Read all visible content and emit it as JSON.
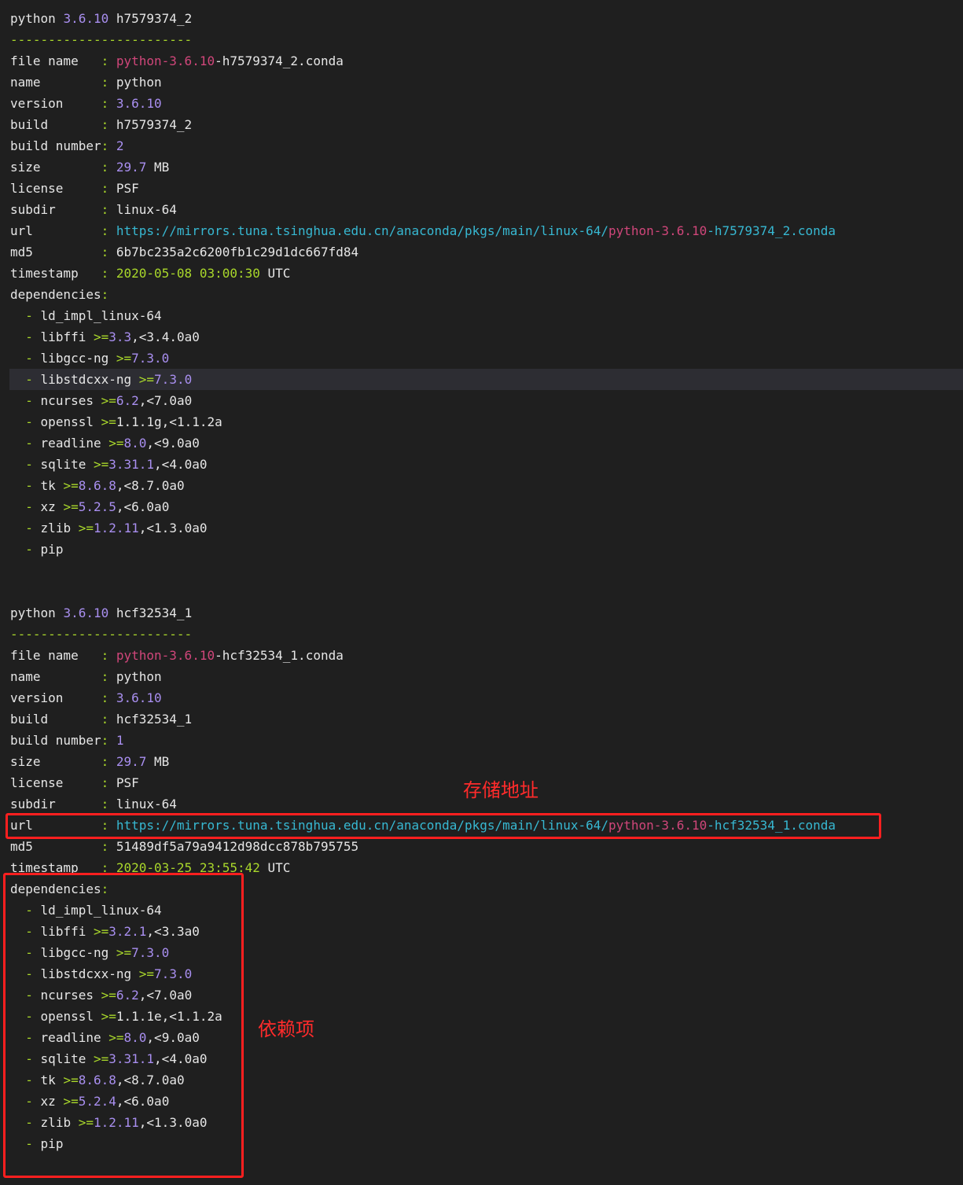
{
  "blocks": [
    {
      "title": [
        "python ",
        "3.6.10",
        " h7579374_2"
      ],
      "separator": "------------------------",
      "fields": [
        {
          "key": "file name   ",
          "value": [
            [
              "s",
              "python-3.6.10"
            ],
            [
              "w",
              "-h7579374_2.conda"
            ]
          ]
        },
        {
          "key": "name        ",
          "value": [
            [
              "w",
              "python"
            ]
          ]
        },
        {
          "key": "version     ",
          "value": [
            [
              "n",
              "3.6.10"
            ]
          ]
        },
        {
          "key": "build       ",
          "value": [
            [
              "w",
              "h7579374_2"
            ]
          ]
        },
        {
          "key": "build number",
          "value": [
            [
              "n",
              "2"
            ]
          ]
        },
        {
          "key": "size        ",
          "value": [
            [
              "n",
              "29.7"
            ],
            [
              "w",
              " MB"
            ]
          ]
        },
        {
          "key": "license     ",
          "value": [
            [
              "w",
              "PSF"
            ]
          ]
        },
        {
          "key": "subdir      ",
          "value": [
            [
              "w",
              "linux-64"
            ]
          ]
        },
        {
          "key": "url         ",
          "value": [
            [
              "b",
              "https://mirrors.tuna.tsinghua.edu.cn/anaconda/pkgs/main/linux-64/"
            ],
            [
              "s",
              "python-3.6.10"
            ],
            [
              "b",
              "-h7579374_2.conda"
            ]
          ]
        },
        {
          "key": "md5         ",
          "value": [
            [
              "w",
              "6b7bc235a2c6200fb1c29d1dc667fd84"
            ]
          ]
        },
        {
          "key": "timestamp   ",
          "value": [
            [
              "g",
              "2020-05-08 03:00:30"
            ],
            [
              "w",
              " UTC"
            ]
          ]
        }
      ],
      "deps_label": "dependencies",
      "deps": [
        [
          [
            "w",
            "ld_impl_linux-64"
          ]
        ],
        [
          [
            "w",
            "libffi "
          ],
          [
            "g",
            ">="
          ],
          [
            "n",
            "3.3"
          ],
          [
            "w",
            ",<3.4.0a0"
          ]
        ],
        [
          [
            "w",
            "libgcc-ng "
          ],
          [
            "g",
            ">="
          ],
          [
            "n",
            "7.3.0"
          ]
        ],
        [
          [
            "w",
            "libstdcxx-ng "
          ],
          [
            "g",
            ">="
          ],
          [
            "n",
            "7.3.0"
          ]
        ],
        [
          [
            "w",
            "ncurses "
          ],
          [
            "g",
            ">="
          ],
          [
            "n",
            "6.2"
          ],
          [
            "w",
            ",<7.0a0"
          ]
        ],
        [
          [
            "w",
            "openssl "
          ],
          [
            "g",
            ">="
          ],
          [
            "w",
            "1.1.1g,<1.1.2a"
          ]
        ],
        [
          [
            "w",
            "readline "
          ],
          [
            "g",
            ">="
          ],
          [
            "n",
            "8.0"
          ],
          [
            "w",
            ",<9.0a0"
          ]
        ],
        [
          [
            "w",
            "sqlite "
          ],
          [
            "g",
            ">="
          ],
          [
            "n",
            "3.31.1"
          ],
          [
            "w",
            ",<4.0a0"
          ]
        ],
        [
          [
            "w",
            "tk "
          ],
          [
            "g",
            ">="
          ],
          [
            "n",
            "8.6.8"
          ],
          [
            "w",
            ",<8.7.0a0"
          ]
        ],
        [
          [
            "w",
            "xz "
          ],
          [
            "g",
            ">="
          ],
          [
            "n",
            "5.2.5"
          ],
          [
            "w",
            ",<6.0a0"
          ]
        ],
        [
          [
            "w",
            "zlib "
          ],
          [
            "g",
            ">="
          ],
          [
            "n",
            "1.2.11"
          ],
          [
            "w",
            ",<1.3.0a0"
          ]
        ],
        [
          [
            "w",
            "pip"
          ]
        ]
      ]
    },
    {
      "title": [
        "python ",
        "3.6.10",
        " hcf32534_1"
      ],
      "separator": "------------------------",
      "fields": [
        {
          "key": "file name   ",
          "value": [
            [
              "s",
              "python-3.6.10"
            ],
            [
              "w",
              "-hcf32534_1.conda"
            ]
          ]
        },
        {
          "key": "name        ",
          "value": [
            [
              "w",
              "python"
            ]
          ]
        },
        {
          "key": "version     ",
          "value": [
            [
              "n",
              "3.6.10"
            ]
          ]
        },
        {
          "key": "build       ",
          "value": [
            [
              "w",
              "hcf32534_1"
            ]
          ]
        },
        {
          "key": "build number",
          "value": [
            [
              "n",
              "1"
            ]
          ]
        },
        {
          "key": "size        ",
          "value": [
            [
              "n",
              "29.7"
            ],
            [
              "w",
              " MB"
            ]
          ]
        },
        {
          "key": "license     ",
          "value": [
            [
              "w",
              "PSF"
            ]
          ]
        },
        {
          "key": "subdir      ",
          "value": [
            [
              "w",
              "linux-64"
            ]
          ]
        },
        {
          "key": "url         ",
          "value": [
            [
              "b",
              "https://mirrors.tuna.tsinghua.edu.cn/anaconda/pkgs/main/linux-64/"
            ],
            [
              "s",
              "python-3.6.10"
            ],
            [
              "b",
              "-hcf32534_1.conda"
            ]
          ]
        },
        {
          "key": "md5         ",
          "value": [
            [
              "w",
              "51489df5a79a9412d98dcc878b795755"
            ]
          ]
        },
        {
          "key": "timestamp   ",
          "value": [
            [
              "g",
              "2020-03-25 23:55:42"
            ],
            [
              "w",
              " UTC"
            ]
          ]
        }
      ],
      "deps_label": "dependencies",
      "deps": [
        [
          [
            "w",
            "ld_impl_linux-64"
          ]
        ],
        [
          [
            "w",
            "libffi "
          ],
          [
            "g",
            ">="
          ],
          [
            "n",
            "3.2.1"
          ],
          [
            "w",
            ",<3.3a0"
          ]
        ],
        [
          [
            "w",
            "libgcc-ng "
          ],
          [
            "g",
            ">="
          ],
          [
            "n",
            "7.3.0"
          ]
        ],
        [
          [
            "w",
            "libstdcxx-ng "
          ],
          [
            "g",
            ">="
          ],
          [
            "n",
            "7.3.0"
          ]
        ],
        [
          [
            "w",
            "ncurses "
          ],
          [
            "g",
            ">="
          ],
          [
            "n",
            "6.2"
          ],
          [
            "w",
            ",<7.0a0"
          ]
        ],
        [
          [
            "w",
            "openssl "
          ],
          [
            "g",
            ">="
          ],
          [
            "w",
            "1.1.1e,<1.1.2a"
          ]
        ],
        [
          [
            "w",
            "readline "
          ],
          [
            "g",
            ">="
          ],
          [
            "n",
            "8.0"
          ],
          [
            "w",
            ",<9.0a0"
          ]
        ],
        [
          [
            "w",
            "sqlite "
          ],
          [
            "g",
            ">="
          ],
          [
            "n",
            "3.31.1"
          ],
          [
            "w",
            ",<4.0a0"
          ]
        ],
        [
          [
            "w",
            "tk "
          ],
          [
            "g",
            ">="
          ],
          [
            "n",
            "8.6.8"
          ],
          [
            "w",
            ",<8.7.0a0"
          ]
        ],
        [
          [
            "w",
            "xz "
          ],
          [
            "g",
            ">="
          ],
          [
            "n",
            "5.2.4"
          ],
          [
            "w",
            ",<6.0a0"
          ]
        ],
        [
          [
            "w",
            "zlib "
          ],
          [
            "g",
            ">="
          ],
          [
            "n",
            "1.2.11"
          ],
          [
            "w",
            ",<1.3.0a0"
          ]
        ],
        [
          [
            "w",
            "pip"
          ]
        ]
      ]
    }
  ],
  "annotations": {
    "url_label": "存储地址",
    "deps_label": "依赖项"
  },
  "colors": {
    "background": "#1f1f1f",
    "text": "#e6e6e6",
    "number": "#a98ff0",
    "string": "#d0467a",
    "green": "#a9d72b",
    "url": "#37b8d2",
    "annotation_red": "#ff1f1f"
  }
}
